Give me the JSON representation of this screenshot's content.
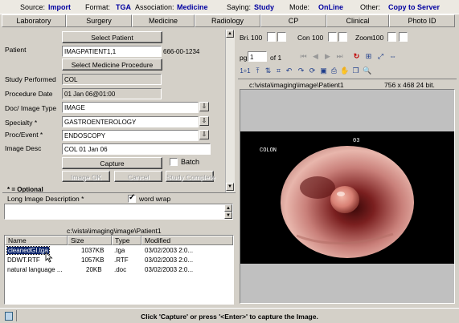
{
  "info": {
    "source_label": "Source:",
    "source": "Import",
    "format_label": "Format:",
    "format": "TGA",
    "association_label": "Association:",
    "association": "Medicine",
    "saying_label": "Saying:",
    "saying": "Study",
    "mode_label": "Mode:",
    "mode": "OnLine",
    "other_label": "Other:",
    "other": "Copy to Server"
  },
  "tabs": [
    "Laboratory",
    "Surgery",
    "Medicine",
    "Radiology",
    "CP",
    "Clinical",
    "Photo ID"
  ],
  "form": {
    "select_patient": "Select Patient",
    "patient_label": "Patient",
    "patient_value": "IMAGPATIENT1,1",
    "patient_id": "666-00-1234",
    "select_procedure": "Select Medicine Procedure",
    "study_label": "Study Performed",
    "study_value": "COL",
    "date_label": "Procedure Date",
    "date_value": "01 Jan 06@01:00",
    "doctype_label": "Doc/ Image Type",
    "doctype_value": "IMAGE",
    "specialty_label": "Specialty *",
    "specialty_value": "GASTROENTEROLOGY",
    "proc_label": "Proc/Event *",
    "proc_value": "ENDOSCOPY",
    "desc_label": "Image Desc",
    "desc_value": "COL 01 Jan 06",
    "capture": "Capture",
    "batch": "Batch",
    "image_ok": "Image OK",
    "cancel": "Cancel",
    "study_complete": "Study Complete",
    "optional": "* = Optional",
    "long_desc_label": "Long Image Description *",
    "word_wrap": "word wrap",
    "folder_path": "c:\\vista\\imaging\\image\\Patient1"
  },
  "files": {
    "columns": [
      "Name",
      "Size",
      "Type",
      "Modified"
    ],
    "rows": [
      {
        "name": "cleanedGI.tga",
        "size": "1037KB",
        "type": ".tga",
        "modified": "03/02/2003  2:0..."
      },
      {
        "name": "DDWT.RTF",
        "size": "1057KB",
        "type": ".RTF",
        "modified": "03/02/2003  2:0..."
      },
      {
        "name": "natural language ...",
        "size": "20KB",
        "type": ".doc",
        "modified": "03/02/2003  2:0..."
      }
    ]
  },
  "viewer": {
    "bri_label": "Bri.",
    "bri_value": "100",
    "con_label": "Con",
    "con_value": "100",
    "zoom_label": "Zoom",
    "zoom_value": "100",
    "pg_label": "pg",
    "pg_value": "1",
    "pg_of": "of 1",
    "ratio_label": "1÷1",
    "path": "c:\\vista\\imaging\\image\\Patient1",
    "dims": "756 x 468 24 bit.",
    "overlay_text": "COLON",
    "overlay_num": "03"
  },
  "status": {
    "message": "Click 'Capture' or press '<Enter>' to capture the Image."
  }
}
